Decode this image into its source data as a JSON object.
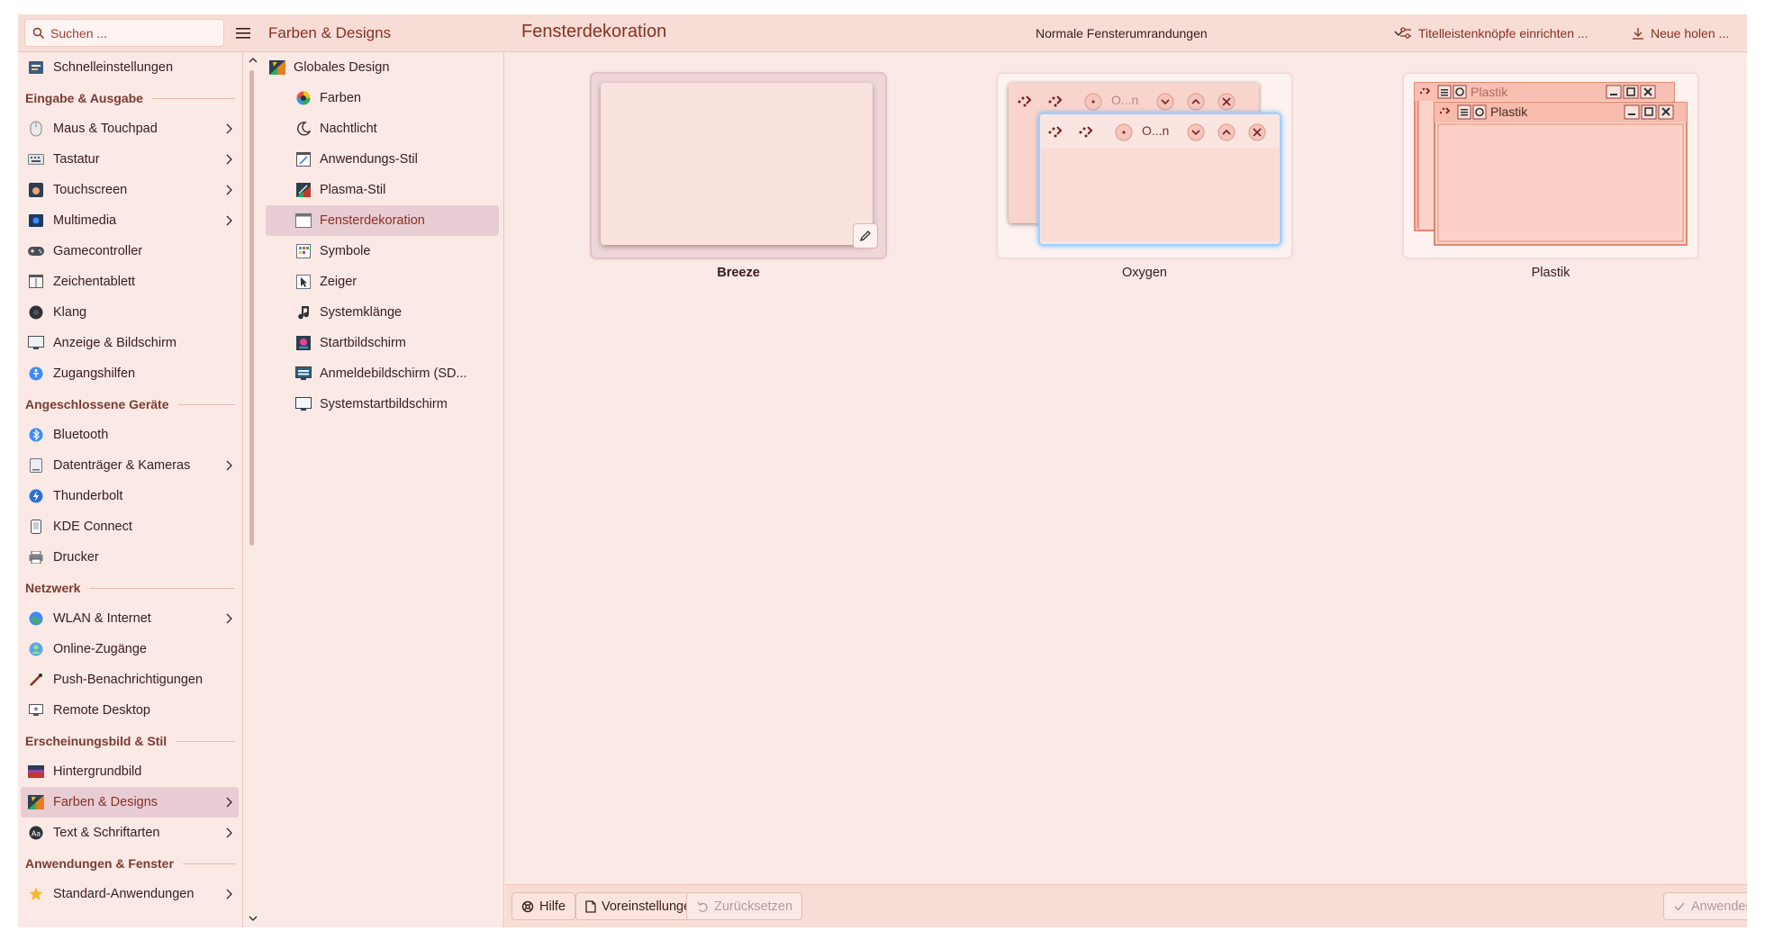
{
  "search": {
    "placeholder": "Suchen ..."
  },
  "header": {
    "mid_title": "Farben & Designs",
    "main_title": "Fensterdekoration",
    "border_select": "Normale Fensterumrandungen",
    "titlebar_button": "Titelleistenknöpfe einrichten ...",
    "newstuff_button": "Neue holen ..."
  },
  "sidebar": {
    "top_item": "Schnelleinstellungen",
    "sections": [
      {
        "title": "Eingabe & Ausgabe",
        "items": [
          "Maus & Touchpad",
          "Tastatur",
          "Touchscreen",
          "Multimedia",
          "Gamecontroller",
          "Zeichentablett",
          "Klang",
          "Anzeige & Bildschirm",
          "Zugangshilfen"
        ]
      },
      {
        "title": "Angeschlossene Geräte",
        "items": [
          "Bluetooth",
          "Datenträger & Kameras",
          "Thunderbolt",
          "KDE Connect",
          "Drucker"
        ]
      },
      {
        "title": "Netzwerk",
        "items": [
          "WLAN & Internet",
          "Online-Zugänge",
          "Push-Benachrichtigungen",
          "Remote Desktop"
        ]
      },
      {
        "title": "Erscheinungsbild & Stil",
        "items": [
          "Hintergrundbild",
          "Farben & Designs",
          "Text & Schriftarten"
        ]
      },
      {
        "title": "Anwendungen & Fenster",
        "items": [
          "Standard-Anwendungen"
        ]
      }
    ]
  },
  "midcol": {
    "top": "Globales Design",
    "items": [
      "Farben",
      "Nachtlicht",
      "Anwendungs-Stil",
      "Plasma-Stil",
      "Fensterdekoration",
      "Symbole",
      "Zeiger",
      "Systemklänge",
      "Startbildschirm",
      "Anmeldebildschirm (SD...",
      "Systemstartbildschirm"
    ]
  },
  "themes": [
    {
      "name": "Breeze"
    },
    {
      "name": "Oxygen",
      "preview_title": "O...n"
    },
    {
      "name": "Plastik",
      "preview_title": "Plastik"
    }
  ],
  "footer": {
    "help": "Hilfe",
    "defaults": "Voreinstellungen",
    "reset": "Zurücksetzen",
    "apply": "Anwenden"
  },
  "colors": {
    "accent": "#8a2f22",
    "background": "#fbe9e5",
    "header": "#f8ddd7",
    "selection": "#e8cdd4"
  }
}
